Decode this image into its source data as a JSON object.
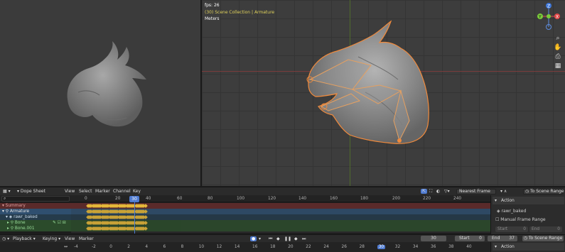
{
  "viewport": {
    "fps": "fps: 26",
    "collection": "(30) Scene Collection | Armature",
    "units": "Meters"
  },
  "gizmo": {
    "x": "X",
    "y": "Y",
    "z": "Z"
  },
  "dopesheet": {
    "mode": "Dope Sheet",
    "menus": [
      "View",
      "Select",
      "Marker",
      "Channel",
      "Key"
    ],
    "interpolation": "Nearest Frame",
    "to_scene_range": "To Scene Range",
    "ruler_ticks": [
      "0",
      "20",
      "40",
      "60",
      "80",
      "100",
      "120",
      "140",
      "160",
      "180",
      "200",
      "220",
      "240"
    ],
    "current_frame": "30",
    "channels": [
      {
        "label": "Summary",
        "color": "#5a2a2a",
        "text": "#e0a0a0"
      },
      {
        "label": "Armature",
        "color": "#2f4f6f",
        "text": "#e6e6e6"
      },
      {
        "label": "rawr_baked",
        "color": "#253b4b",
        "text": "#cde"
      },
      {
        "label": "Bone",
        "color": "#2b4b2b",
        "text": "#9d9"
      },
      {
        "label": "Bone.001",
        "color": "#2b4b2b",
        "text": "#9d9"
      }
    ],
    "sidebar": {
      "action_header": "Action",
      "action_name": "rawr_baked",
      "manual_range": "Manual Frame Range",
      "start_label": "Start",
      "start_value": "0",
      "end_label": "End",
      "end_value": "0"
    }
  },
  "timeline": {
    "playback": "Playback",
    "keying": "Keying",
    "view": "View",
    "marker": "Marker",
    "frame": "30",
    "start_label": "Start",
    "start_value": "0",
    "end_label": "End",
    "end_value": "37",
    "to_scene_range": "To Scene Range",
    "ticks": [
      "-4",
      "-2",
      "0",
      "2",
      "4",
      "6",
      "8",
      "10",
      "12",
      "14",
      "16",
      "18",
      "20",
      "22",
      "24",
      "26",
      "28",
      "30",
      "32",
      "34",
      "36",
      "38",
      "40"
    ],
    "action_header": "Action"
  }
}
